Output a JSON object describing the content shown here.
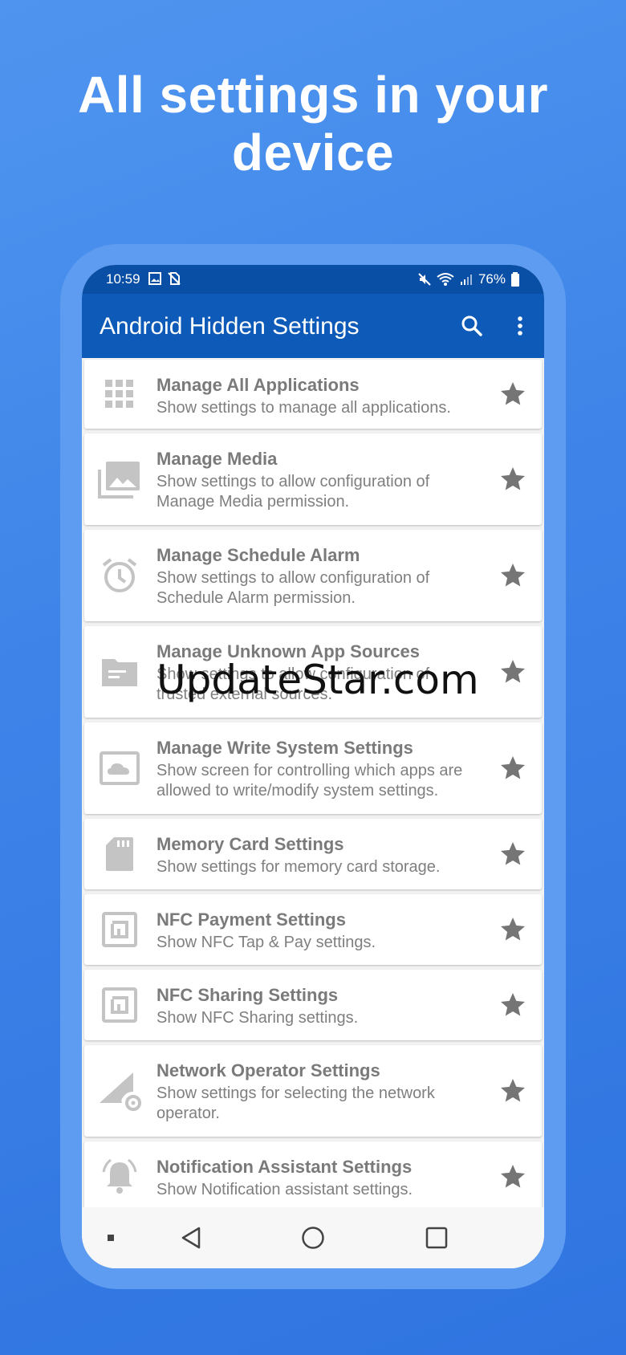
{
  "headline": "All settings in your device",
  "status_bar": {
    "time": "10:59",
    "battery": "76%"
  },
  "app_bar": {
    "title": "Android Hidden Settings",
    "search_icon": "search-icon",
    "menu_icon": "more-vert-icon"
  },
  "items": [
    {
      "title": "Manage All Applications",
      "desc": "Show settings to manage all applications.",
      "icon": "apps-grid-icon"
    },
    {
      "title": "Manage Media",
      "desc": "Show settings to allow configuration of Manage Media permission.",
      "icon": "photo-library-icon"
    },
    {
      "title": "Manage Schedule Alarm",
      "desc": "Show settings to allow configuration of Schedule Alarm permission.",
      "icon": "alarm-icon"
    },
    {
      "title": "Manage Unknown App Sources",
      "desc": "Show settings to allow configuration of trusted external sources.",
      "icon": "folder-icon"
    },
    {
      "title": "Manage Write System Settings",
      "desc": "Show screen for controlling which apps are allowed to write/modify system settings.",
      "icon": "settings-system-icon"
    },
    {
      "title": "Memory Card Settings",
      "desc": "Show settings for memory card storage.",
      "icon": "sd-card-icon"
    },
    {
      "title": "NFC Payment Settings",
      "desc": "Show NFC Tap & Pay settings.",
      "icon": "nfc-icon"
    },
    {
      "title": "NFC Sharing Settings",
      "desc": "Show NFC Sharing settings.",
      "icon": "nfc-icon"
    },
    {
      "title": "Network Operator Settings",
      "desc": "Show settings for selecting the network operator.",
      "icon": "network-settings-icon"
    },
    {
      "title": "Notification Assistant Settings",
      "desc": "Show Notification assistant settings.",
      "icon": "notification-bell-icon"
    }
  ],
  "watermark": "UpdateStar.com",
  "colors": {
    "background": "#3d83e8",
    "app_bar": "#0d5ab8",
    "status_bar": "#0a4fa6",
    "icon_gray": "#c4c4c4",
    "star_gray": "#757575"
  }
}
